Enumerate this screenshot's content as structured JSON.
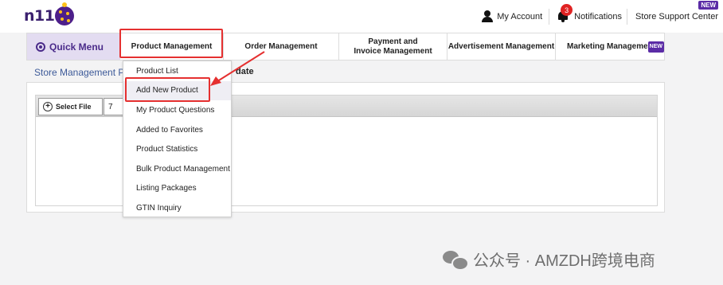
{
  "header": {
    "logo_text": "n11",
    "account_label": "My Account",
    "notifications_label": "Notifications",
    "notifications_count": "3",
    "support_label": "Store Support Center",
    "support_new_tag": "NEW"
  },
  "nav": {
    "quick_menu_label": "Quick Menu",
    "items": [
      {
        "label": "Product Management"
      },
      {
        "label": "Order Management"
      },
      {
        "label": "Payment and Invoice Management"
      },
      {
        "label": "Advertisement Management"
      },
      {
        "label": "Marketing Management"
      }
    ],
    "marketing_new_tag": "NEW"
  },
  "breadcrumb": {
    "text": "Store Management Pa",
    "right_fragment": "date"
  },
  "panel": {
    "select_file_label": "Select File",
    "second_button_label": "7"
  },
  "dropdown": {
    "items": [
      {
        "label": "Product List"
      },
      {
        "label": "Add New Product"
      },
      {
        "label": "My Product Questions"
      },
      {
        "label": "Added to Favorites"
      },
      {
        "label": "Product Statistics"
      },
      {
        "label": "Bulk Product Management"
      },
      {
        "label": "Listing Packages"
      },
      {
        "label": "GTIN Inquiry"
      }
    ]
  },
  "watermark": {
    "text": "公众号 · AMZDH跨境电商"
  },
  "colors": {
    "brand_purple": "#4a2b8a",
    "highlight_red": "#e53030",
    "badge_red": "#e02222"
  }
}
